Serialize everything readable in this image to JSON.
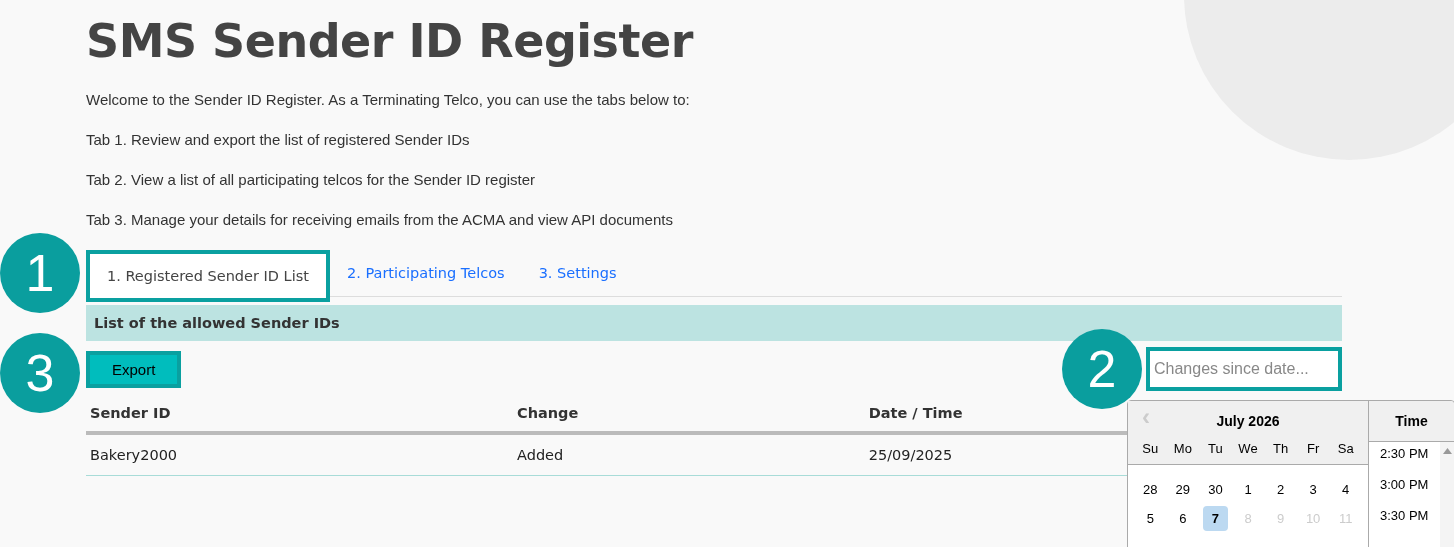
{
  "title": "SMS Sender ID Register",
  "intro": [
    "Welcome to the Sender ID Register. As a Terminating Telco, you can use the tabs below to:",
    "Tab 1. Review and export the list of registered Sender IDs",
    "Tab 2. View a list of all participating telcos for the Sender ID register",
    "Tab 3. Manage your details for receiving emails from the ACMA and view API documents"
  ],
  "tabs": [
    {
      "label": "1. Registered Sender ID List",
      "selected": true,
      "callout": "1"
    },
    {
      "label": "2. Participating Telcos",
      "selected": false
    },
    {
      "label": "3. Settings",
      "selected": false
    }
  ],
  "section_header": "List of the allowed Sender IDs",
  "export_button": {
    "label": "Export",
    "callout": "3"
  },
  "date_filter": {
    "placeholder": "Changes since date...",
    "callout": "2"
  },
  "table": {
    "columns": [
      "Sender ID",
      "Change",
      "Date / Time"
    ],
    "rows": [
      [
        "Bakery2000",
        "Added",
        "25/09/2025"
      ]
    ]
  },
  "datepicker": {
    "prev": "‹",
    "month": "July 2026",
    "weekdays": [
      "Su",
      "Mo",
      "Tu",
      "We",
      "Th",
      "Fr",
      "Sa"
    ],
    "weeks": [
      [
        {
          "day": "28",
          "selected": false,
          "disabled": false
        },
        {
          "day": "29",
          "selected": false,
          "disabled": false
        },
        {
          "day": "30",
          "selected": false,
          "disabled": false
        },
        {
          "day": "1",
          "selected": false,
          "disabled": false
        },
        {
          "day": "2",
          "selected": false,
          "disabled": false
        },
        {
          "day": "3",
          "selected": false,
          "disabled": false
        },
        {
          "day": "4",
          "selected": false,
          "disabled": false
        }
      ],
      [
        {
          "day": "5",
          "selected": false,
          "disabled": false
        },
        {
          "day": "6",
          "selected": false,
          "disabled": false
        },
        {
          "day": "7",
          "selected": true,
          "disabled": false
        },
        {
          "day": "8",
          "selected": false,
          "disabled": true
        },
        {
          "day": "9",
          "selected": false,
          "disabled": true
        },
        {
          "day": "10",
          "selected": false,
          "disabled": true
        },
        {
          "day": "11",
          "selected": false,
          "disabled": true
        }
      ]
    ],
    "time_header": "Time",
    "times": [
      "2:30 PM",
      "3:00 PM",
      "3:30 PM"
    ]
  }
}
